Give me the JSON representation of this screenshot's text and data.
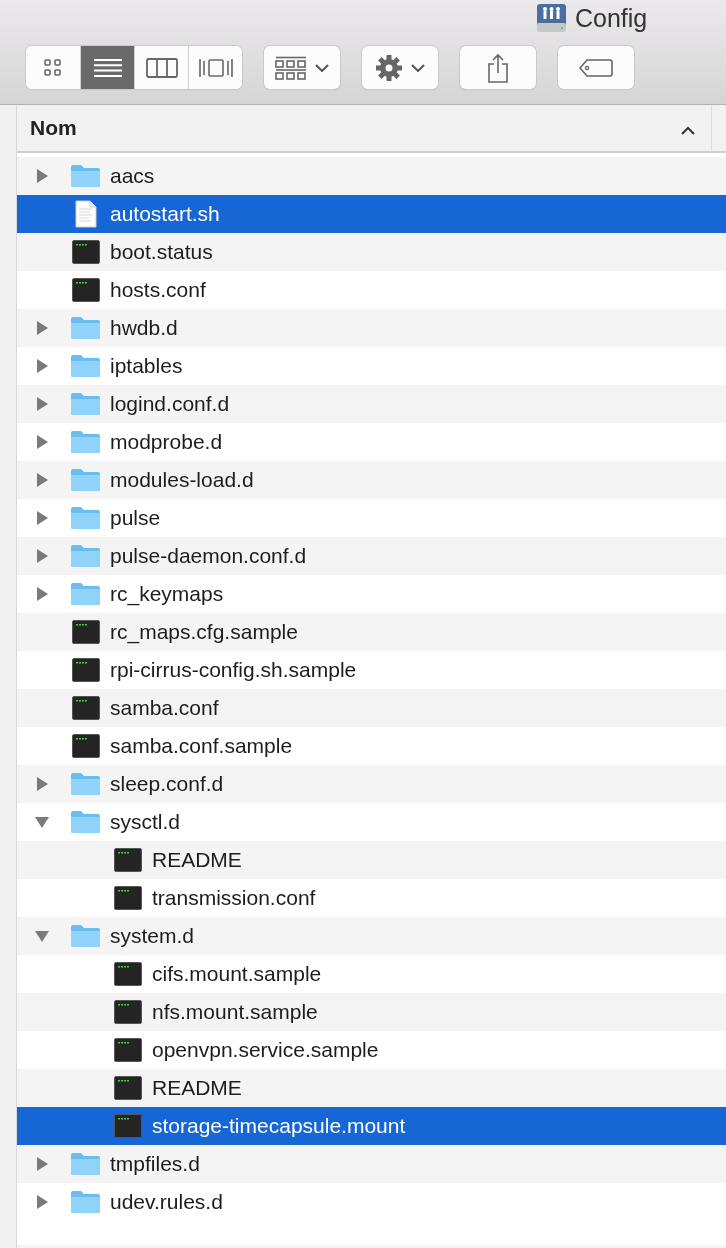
{
  "window": {
    "title": "Config"
  },
  "toolbar": {
    "view_modes": [
      {
        "kind": "icons",
        "selected": false
      },
      {
        "kind": "list",
        "selected": true
      },
      {
        "kind": "columns",
        "selected": false
      },
      {
        "kind": "coverflow",
        "selected": false
      }
    ]
  },
  "column": {
    "label": "Nom",
    "ascending": true
  },
  "files": [
    {
      "name": "aacs",
      "kind": "folder",
      "expanded": false,
      "selected": false
    },
    {
      "name": "autostart.sh",
      "kind": "document",
      "selected": true
    },
    {
      "name": "boot.status",
      "kind": "exec",
      "selected": false
    },
    {
      "name": "hosts.conf",
      "kind": "exec",
      "selected": false
    },
    {
      "name": "hwdb.d",
      "kind": "folder",
      "expanded": false,
      "selected": false
    },
    {
      "name": "iptables",
      "kind": "folder",
      "expanded": false,
      "selected": false
    },
    {
      "name": "logind.conf.d",
      "kind": "folder",
      "expanded": false,
      "selected": false
    },
    {
      "name": "modprobe.d",
      "kind": "folder",
      "expanded": false,
      "selected": false
    },
    {
      "name": "modules-load.d",
      "kind": "folder",
      "expanded": false,
      "selected": false
    },
    {
      "name": "pulse",
      "kind": "folder",
      "expanded": false,
      "selected": false
    },
    {
      "name": "pulse-daemon.conf.d",
      "kind": "folder",
      "expanded": false,
      "selected": false
    },
    {
      "name": "rc_keymaps",
      "kind": "folder",
      "expanded": false,
      "selected": false
    },
    {
      "name": "rc_maps.cfg.sample",
      "kind": "exec",
      "selected": false
    },
    {
      "name": "rpi-cirrus-config.sh.sample",
      "kind": "exec",
      "selected": false
    },
    {
      "name": "samba.conf",
      "kind": "exec",
      "selected": false
    },
    {
      "name": "samba.conf.sample",
      "kind": "exec",
      "selected": false
    },
    {
      "name": "sleep.conf.d",
      "kind": "folder",
      "expanded": false,
      "selected": false
    },
    {
      "name": "sysctl.d",
      "kind": "folder",
      "expanded": true,
      "selected": false,
      "children": [
        {
          "name": "README",
          "kind": "exec",
          "selected": false
        },
        {
          "name": "transmission.conf",
          "kind": "exec",
          "selected": false
        }
      ]
    },
    {
      "name": "system.d",
      "kind": "folder",
      "expanded": true,
      "selected": false,
      "children": [
        {
          "name": "cifs.mount.sample",
          "kind": "exec",
          "selected": false
        },
        {
          "name": "nfs.mount.sample",
          "kind": "exec",
          "selected": false
        },
        {
          "name": "openvpn.service.sample",
          "kind": "exec",
          "selected": false
        },
        {
          "name": "README",
          "kind": "exec",
          "selected": false
        },
        {
          "name": "storage-timecapsule.mount",
          "kind": "exec",
          "selected": true
        }
      ]
    },
    {
      "name": "tmpfiles.d",
      "kind": "folder",
      "expanded": false,
      "selected": false
    },
    {
      "name": "udev.rules.d",
      "kind": "folder",
      "expanded": false,
      "selected": false
    }
  ]
}
